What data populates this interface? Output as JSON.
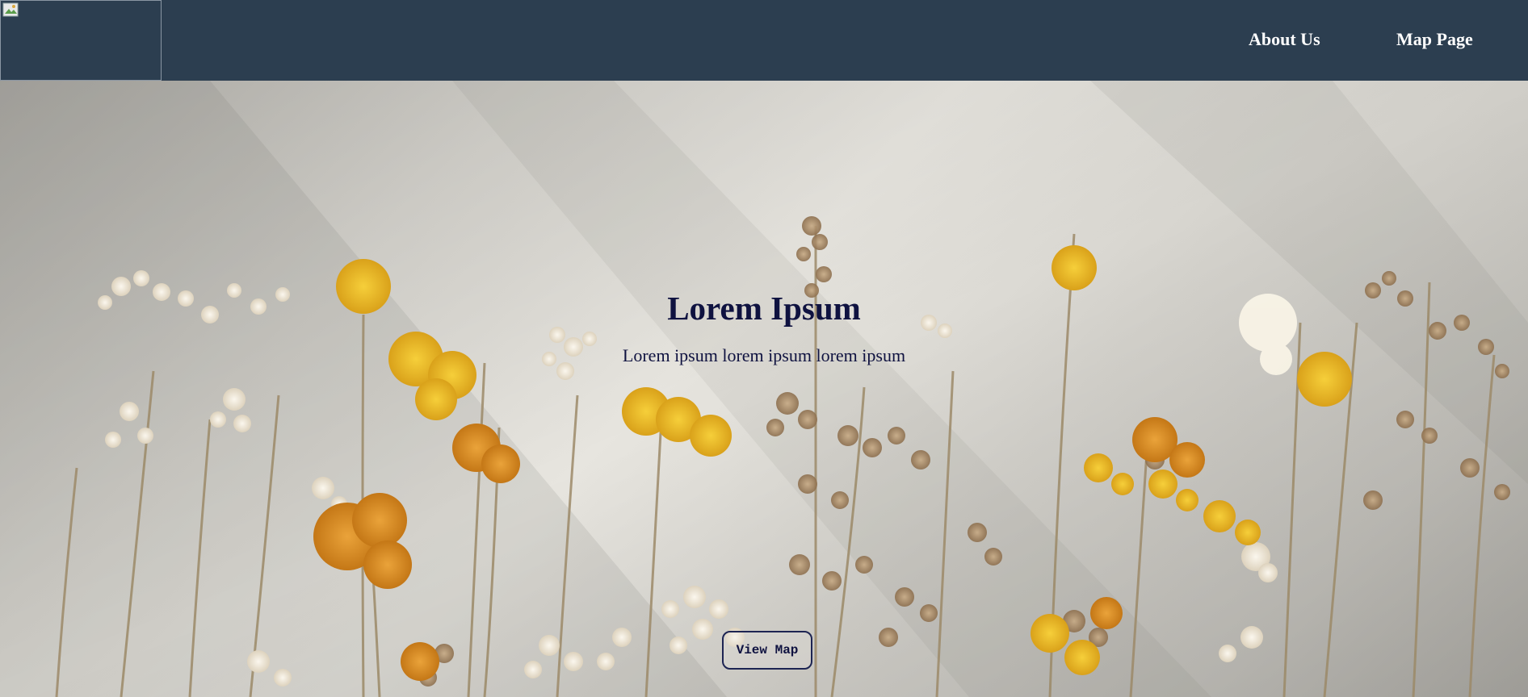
{
  "nav": {
    "logo_alt": "",
    "links": [
      {
        "label": "About Us"
      },
      {
        "label": "Map Page"
      }
    ]
  },
  "hero": {
    "title": "Lorem Ipsum",
    "subtitle": "Lorem ipsum lorem ipsum lorem ipsum",
    "button_label": "View Map",
    "background_description_icon": "dried-flowers-photo"
  },
  "colors": {
    "navbar": "#2c3e50",
    "nav_text": "#ffffff",
    "hero_text": "#0f1240",
    "flower_yellow": "#e8b520",
    "flower_orange": "#d98b1e",
    "flower_cream": "#f3ede0",
    "stem": "#9c8a68"
  }
}
